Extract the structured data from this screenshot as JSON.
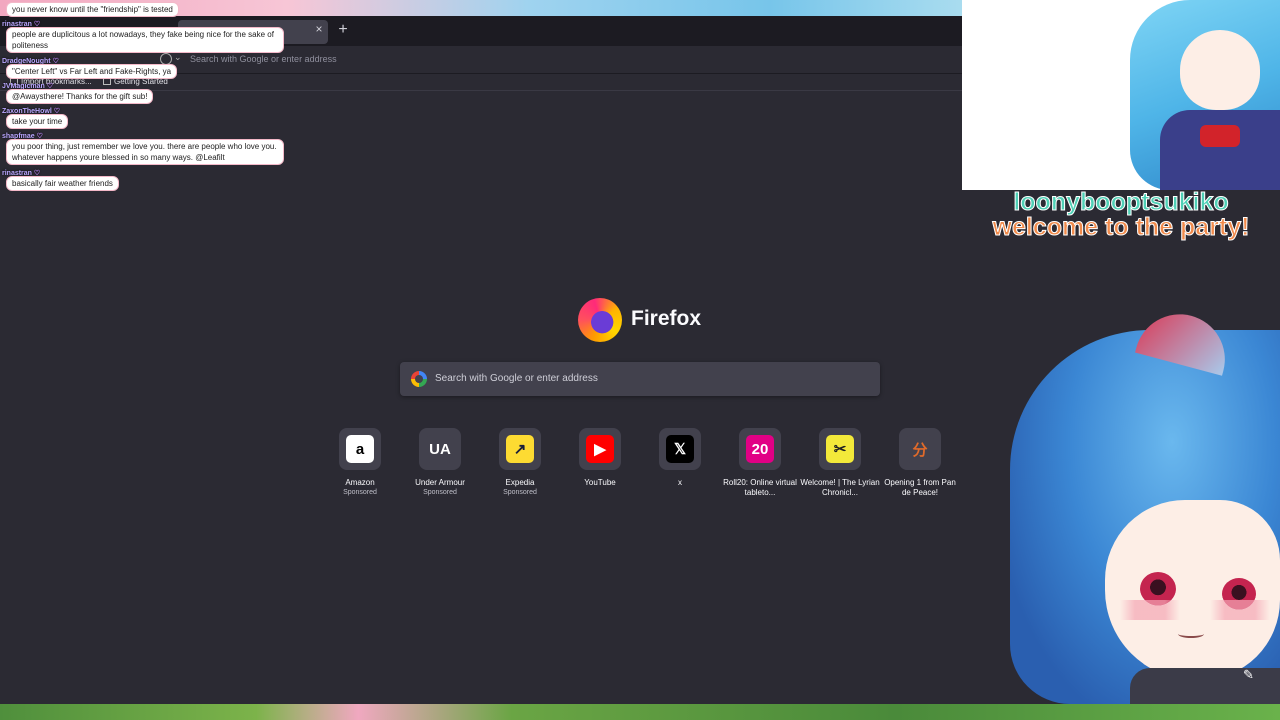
{
  "browser": {
    "urlbar_placeholder": "Search with Google or enter address",
    "tab_close": "×",
    "new_tab": "+",
    "bookmarks": [
      "Import bookmarks...",
      "Getting Started"
    ]
  },
  "newtab": {
    "brand": "Firefox",
    "search_placeholder": "Search with Google or enter address",
    "sponsored_label": "Sponsored",
    "shortcuts": [
      {
        "label": "Amazon",
        "sponsored": true,
        "glyph": "a",
        "fg": "#000000",
        "bg": "#ffffff",
        "icon": "amazon-icon"
      },
      {
        "label": "Under Armour",
        "sponsored": true,
        "glyph": "UA",
        "fg": "#ffffff",
        "bg": "#42414d",
        "icon": "under-armour-icon"
      },
      {
        "label": "Expedia",
        "sponsored": true,
        "glyph": "↗",
        "fg": "#191e3b",
        "bg": "#fddb32",
        "icon": "expedia-icon"
      },
      {
        "label": "YouTube",
        "sponsored": false,
        "glyph": "▶",
        "fg": "#ffffff",
        "bg": "#ff0000",
        "icon": "youtube-icon"
      },
      {
        "label": "x",
        "sponsored": false,
        "glyph": "𝕏",
        "fg": "#ffffff",
        "bg": "#000000",
        "icon": "x-icon"
      },
      {
        "label": "Roll20: Online virtual tableto...",
        "sponsored": false,
        "glyph": "20",
        "fg": "#ffffff",
        "bg": "#e10085",
        "icon": "roll20-icon"
      },
      {
        "label": "Welcome! | The Lyrian Chronicl...",
        "sponsored": false,
        "glyph": "✂",
        "fg": "#222222",
        "bg": "#f3e93a",
        "icon": "lyrian-icon"
      },
      {
        "label": "Opening 1 from Pan de Peace!",
        "sponsored": false,
        "glyph": "分",
        "fg": "#e06a2a",
        "bg": "#42414d",
        "icon": "pan-de-peace-icon"
      }
    ]
  },
  "chat": [
    {
      "user": "",
      "message": "you never know until the \"friendship\" is tested"
    },
    {
      "user": "rinastran",
      "message": "people are duplicitous a lot nowadays, they fake being nice for the sake of politeness"
    },
    {
      "user": "DradgeNought",
      "message": "\"Center Left\" vs Far Left and Fake-Rights, ya"
    },
    {
      "user": "JVMagicman",
      "message": "@Awaysthere! Thanks for the gift sub!"
    },
    {
      "user": "ZaxonTheHowl",
      "message": "take your time"
    },
    {
      "user": "shapfmae",
      "message": "you poor thing, just remember we love you. there are people who love you. whatever happens youre blessed in so many ways. @Leafilt"
    },
    {
      "user": "rinastran",
      "message": "basically fair weather friends"
    }
  ],
  "alert": {
    "name": "loonybooptsukiko",
    "message": "welcome to the party!",
    "name_color": "#4fd0b6",
    "message_color": "#f08a4b"
  }
}
